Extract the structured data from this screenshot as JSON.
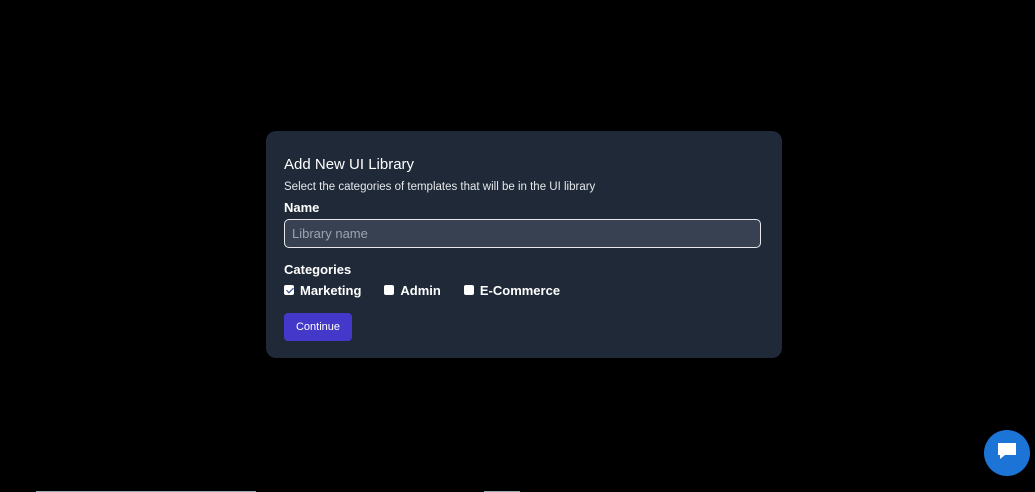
{
  "modal": {
    "title": "Add New UI Library",
    "description": "Select the categories of templates that will be in the UI library",
    "name_label": "Name",
    "name_input": {
      "value": "",
      "placeholder": "Library name"
    },
    "categories_label": "Categories",
    "categories": [
      {
        "label": "Marketing",
        "checked": true
      },
      {
        "label": "Admin",
        "checked": false
      },
      {
        "label": "E-Commerce",
        "checked": false
      }
    ],
    "continue_label": "Continue"
  },
  "colors": {
    "background": "#000000",
    "modal_bg": "#1f2937",
    "button_accent": "#4338ca",
    "chat_bubble": "#1c74d6"
  },
  "icons": {
    "chat": "chat-bubble-icon"
  }
}
